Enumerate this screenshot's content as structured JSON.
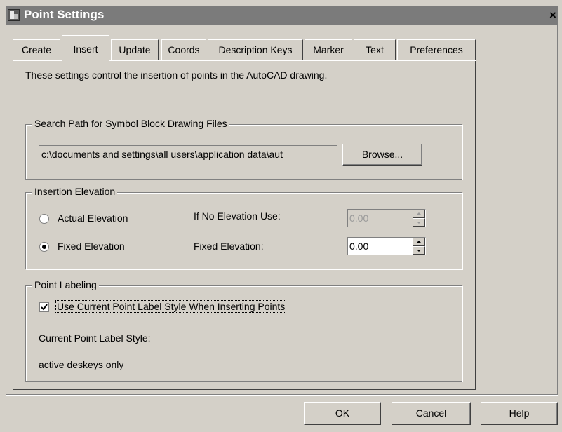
{
  "window": {
    "title": "Point Settings",
    "close_glyph": "×"
  },
  "tabs": [
    {
      "label": "Create",
      "active": false
    },
    {
      "label": "Insert",
      "active": true
    },
    {
      "label": "Update",
      "active": false
    },
    {
      "label": "Coords",
      "active": false
    },
    {
      "label": "Description Keys",
      "active": false
    },
    {
      "label": "Marker",
      "active": false
    },
    {
      "label": "Text",
      "active": false
    },
    {
      "label": "Preferences",
      "active": false
    }
  ],
  "intro": "These settings control the insertion of points in the AutoCAD drawing.",
  "search_path": {
    "legend": "Search Path for Symbol Block Drawing Files",
    "value": "c:\\documents and settings\\all users\\application data\\aut",
    "browse_label": "Browse..."
  },
  "elevation": {
    "legend": "Insertion Elevation",
    "actual_label": "Actual Elevation",
    "fixed_label": "Fixed Elevation",
    "selected": "fixed",
    "no_elev_label": "If No Elevation Use:",
    "no_elev_value": "0.00",
    "fixed_elev_label": "Fixed Elevation:",
    "fixed_elev_value": "0.00"
  },
  "labeling": {
    "legend": "Point Labeling",
    "use_current_label": "Use Current Point Label Style When Inserting Points",
    "use_current_checked": true,
    "current_style_label": "Current Point Label Style:",
    "current_style_value": "active deskeys only"
  },
  "buttons": {
    "ok": "OK",
    "cancel": "Cancel",
    "help": "Help"
  }
}
